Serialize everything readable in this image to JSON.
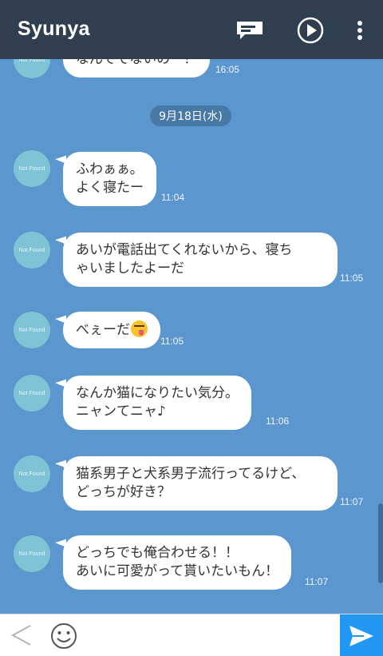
{
  "header": {
    "title": "Syunya",
    "icons": [
      "notes-icon",
      "play-icon",
      "more-vert-icon"
    ]
  },
  "chat": {
    "date_separator": "9月18日(水)",
    "avatar_text": "Not Found",
    "messages": [
      {
        "text": "なんででないのー！",
        "time": "16:05"
      },
      {
        "text": "ふわぁぁ。\nよく寝たー",
        "time": "11:04"
      },
      {
        "text": "あいが電話出てくれないから、寝ち\nゃいましたよーだ",
        "time": "11:05"
      },
      {
        "text": "べぇーだ",
        "emoji": "tongue-out-emoji",
        "time": "11:05"
      },
      {
        "text": "なんか猫になりたい気分。\nニャンてニャ♪",
        "time": "11:06"
      },
      {
        "text": "猫系男子と犬系男子流行ってるけど、\nどっちが好き？",
        "time": "11:07"
      },
      {
        "text": "どっちでも俺合わせる！！\nあいに可愛がって貰いたいもん！",
        "time": "11:07"
      }
    ]
  },
  "bottom_bar": {
    "icons": [
      "back-chevron-icon",
      "smiley-icon",
      "send-icon"
    ],
    "accent_color": "#2196f3"
  },
  "colors": {
    "background": "#5b97ce",
    "topbar": "#2f3f50"
  }
}
